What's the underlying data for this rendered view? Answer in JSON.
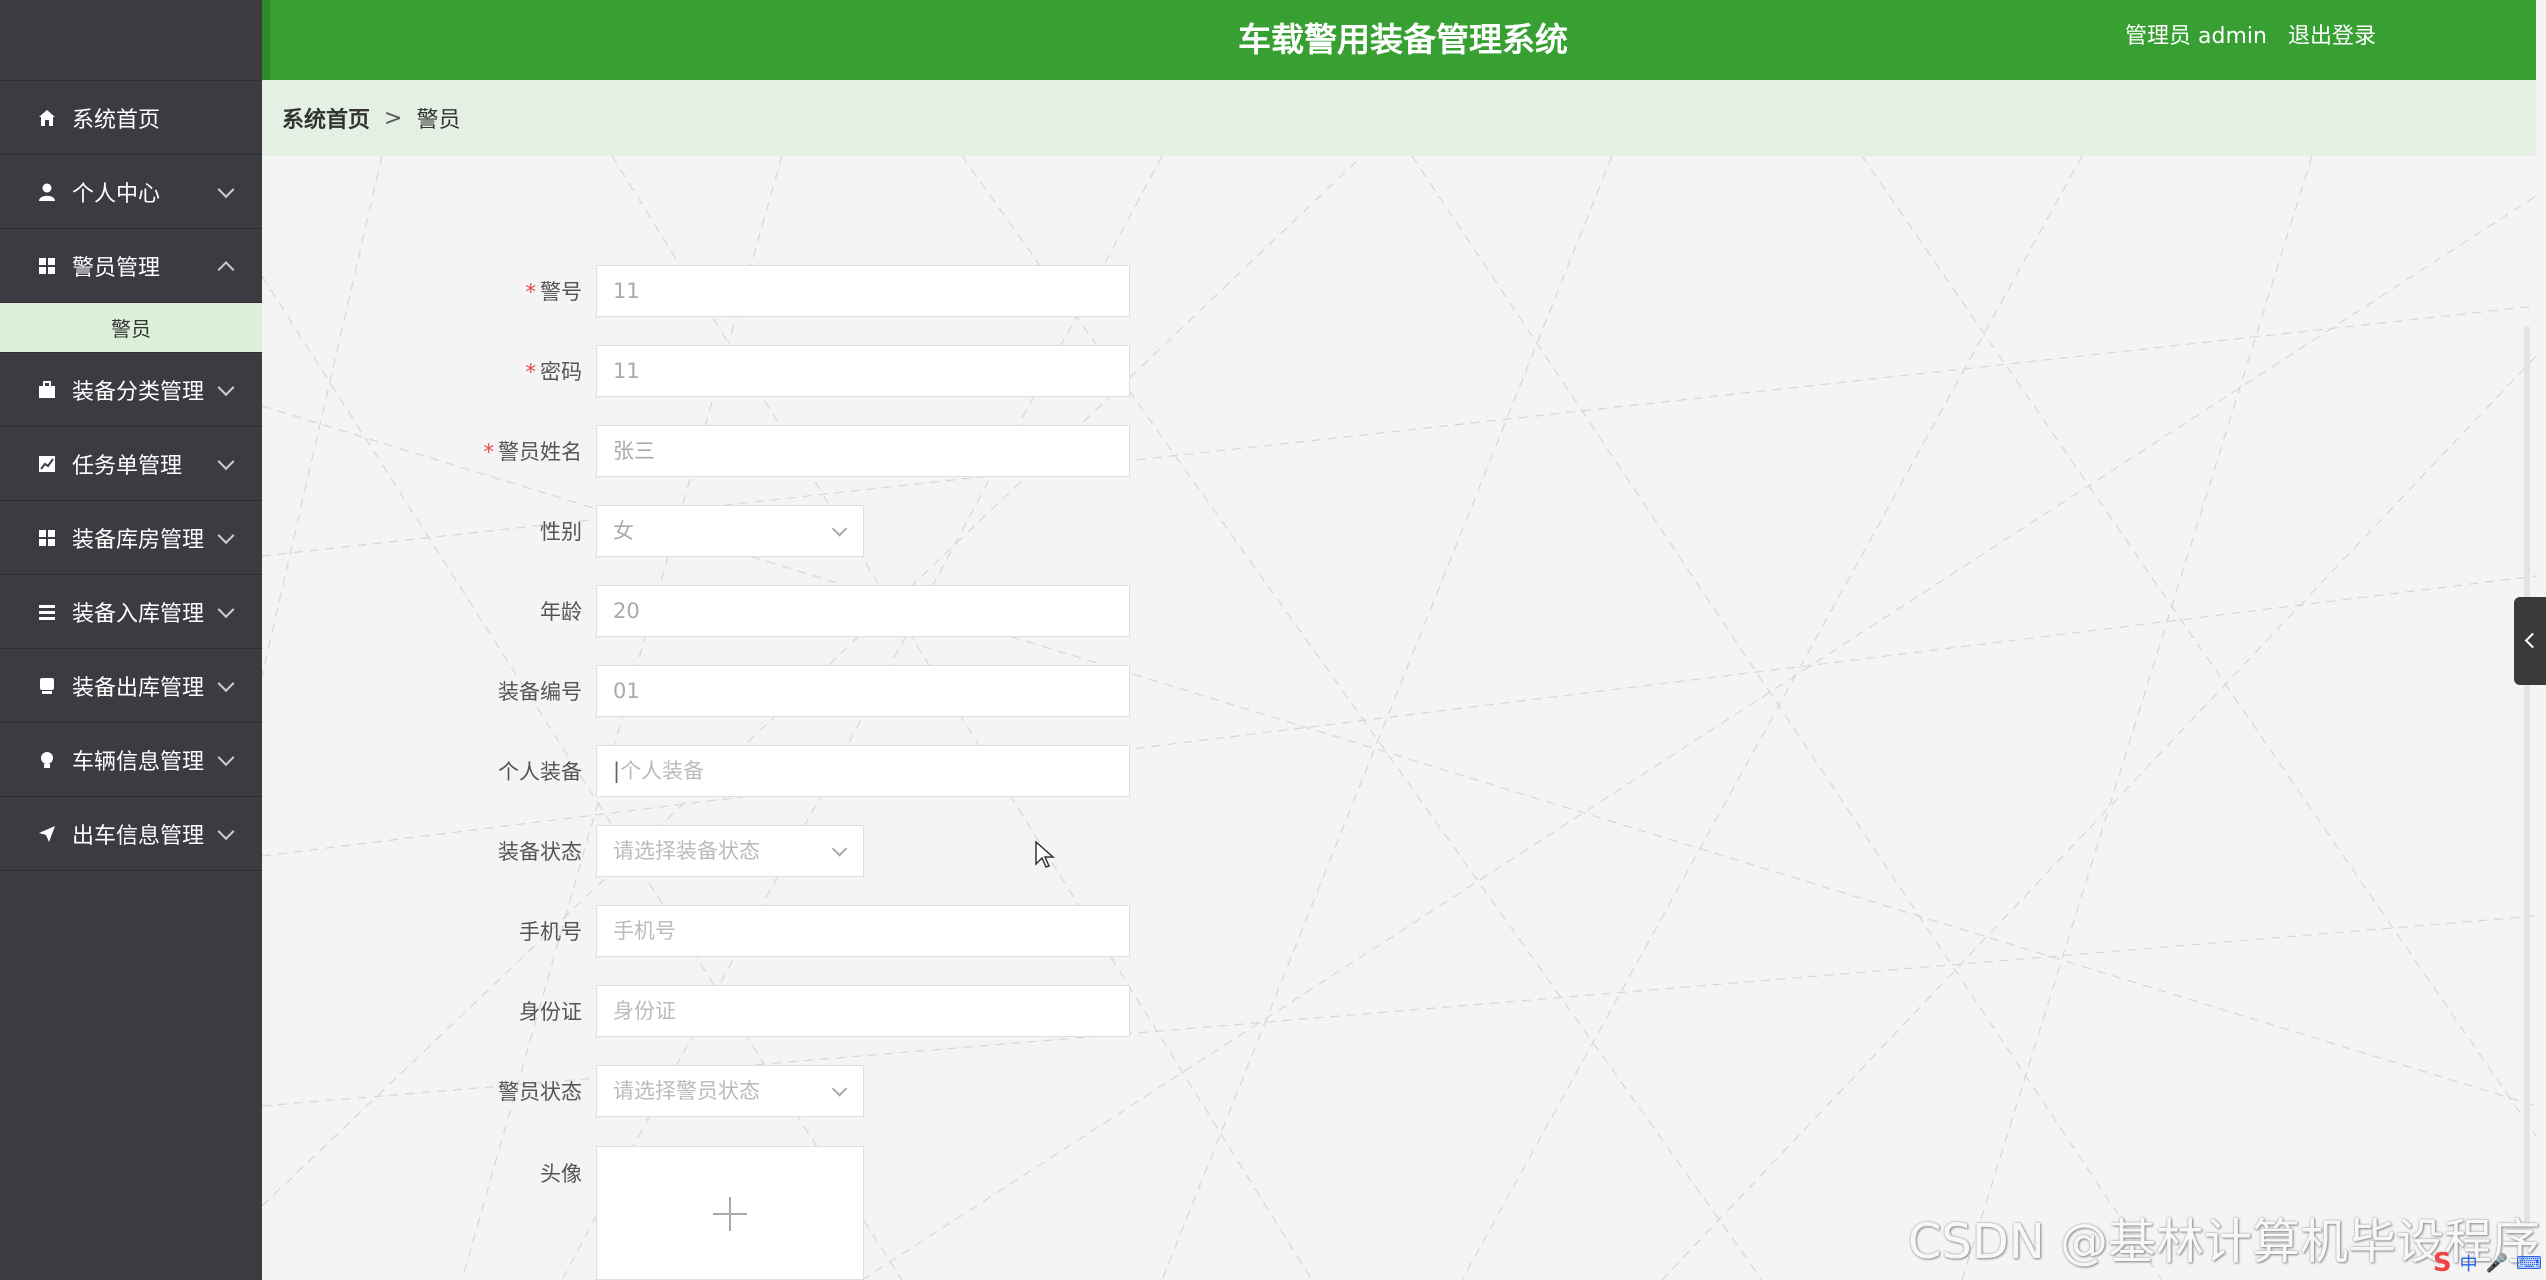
{
  "header": {
    "title": "车载警用装备管理系统",
    "user_label": "管理员 admin",
    "logout_label": "退出登录"
  },
  "sidebar": {
    "items": [
      {
        "label": "系统首页",
        "icon": "home-icon",
        "expanded": false
      },
      {
        "label": "个人中心",
        "icon": "user-icon",
        "expanded": false
      },
      {
        "label": "警员管理",
        "icon": "grid-icon",
        "expanded": true
      },
      {
        "label": "装备分类管理",
        "icon": "briefcase-icon",
        "expanded": false
      },
      {
        "label": "任务单管理",
        "icon": "chart-icon",
        "expanded": false
      },
      {
        "label": "装备库房管理",
        "icon": "grid-icon",
        "expanded": false
      },
      {
        "label": "装备入库管理",
        "icon": "list-icon",
        "expanded": false
      },
      {
        "label": "装备出库管理",
        "icon": "box-icon",
        "expanded": false
      },
      {
        "label": "车辆信息管理",
        "icon": "bulb-icon",
        "expanded": false
      },
      {
        "label": "出车信息管理",
        "icon": "send-icon",
        "expanded": false
      }
    ],
    "active_submenu": "警员"
  },
  "breadcrumb": {
    "home": "系统首页",
    "separator": ">",
    "current": "警员"
  },
  "form": {
    "police_no": {
      "label": "警号",
      "value": "11",
      "required": true
    },
    "password": {
      "label": "密码",
      "value": "11",
      "required": true
    },
    "name": {
      "label": "警员姓名",
      "value": "张三",
      "required": true
    },
    "gender": {
      "label": "性别",
      "value": "女"
    },
    "age": {
      "label": "年龄",
      "value": "20"
    },
    "equip_no": {
      "label": "装备编号",
      "value": "01"
    },
    "personal_equip": {
      "label": "个人装备",
      "placeholder": "个人装备"
    },
    "equip_status": {
      "label": "装备状态",
      "placeholder": "请选择装备状态"
    },
    "phone": {
      "label": "手机号",
      "placeholder": "手机号"
    },
    "id_card": {
      "label": "身份证",
      "placeholder": "身份证"
    },
    "police_status": {
      "label": "警员状态",
      "placeholder": "请选择警员状态"
    },
    "avatar": {
      "label": "头像"
    }
  },
  "watermark": "CSDN @基林计算机毕设程序",
  "ime": {
    "s": "S",
    "zh": "中"
  },
  "colors": {
    "header": "#38a033",
    "sidebar": "#3c3b41",
    "breadcrumb_bg": "#e4f0e3",
    "submenu_active": "#dcefd9",
    "required": "#e5484d"
  }
}
